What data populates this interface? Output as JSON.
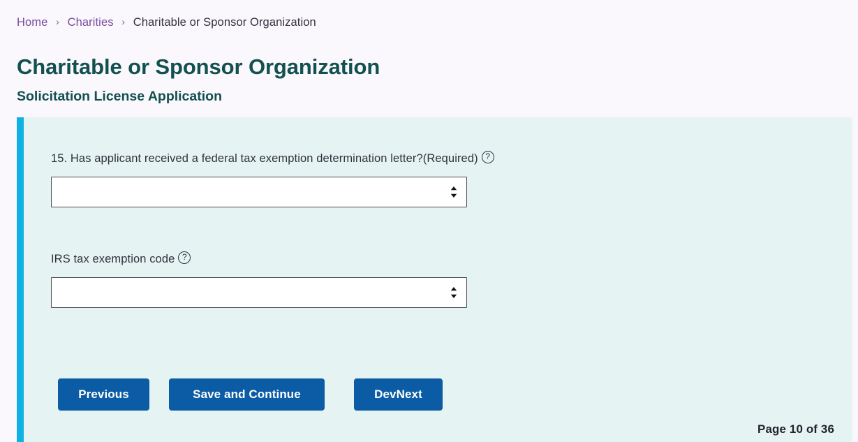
{
  "breadcrumb": {
    "items": [
      {
        "label": "Home",
        "type": "link"
      },
      {
        "label": "Charities",
        "type": "link"
      },
      {
        "label": "Charitable or Sponsor Organization",
        "type": "current"
      }
    ],
    "separator": "›"
  },
  "header": {
    "title": "Charitable or Sponsor Organization",
    "subtitle": "Solicitation License Application"
  },
  "form": {
    "accent_color": "#0fb2e2",
    "panel_background": "#e5f4f3",
    "fields": [
      {
        "label": "15. Has applicant received a federal tax exemption determination letter?(Required)",
        "help_icon": "question-circle-icon",
        "control": "select",
        "value": "",
        "options": [
          ""
        ]
      },
      {
        "label": "IRS tax exemption code",
        "help_icon": "question-circle-icon",
        "control": "select",
        "value": "",
        "options": [
          ""
        ]
      }
    ]
  },
  "actions": {
    "previous_label": "Previous",
    "save_label": "Save and Continue",
    "devnext_label": "DevNext",
    "button_color": "#0b5ca5"
  },
  "footer": {
    "page_counter": "Page 10 of 36"
  },
  "theme": {
    "page_background": "#faf7fd",
    "heading_color": "#12514f",
    "link_color": "#7b4d9e"
  }
}
